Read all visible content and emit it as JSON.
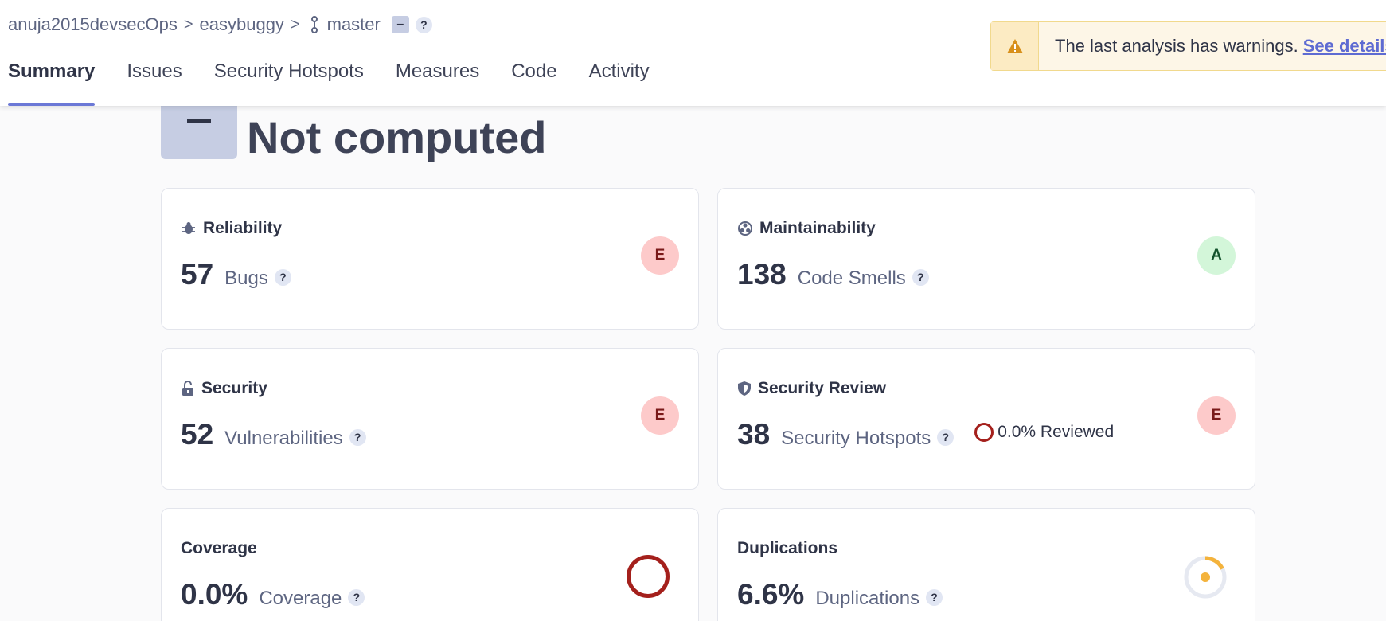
{
  "breadcrumb": {
    "organization": "anuja2015devsecOps",
    "project": "easybuggy",
    "branch": "master",
    "sep": ">",
    "badge": "–",
    "help": "?"
  },
  "tabs": [
    {
      "label": "Summary",
      "active": true
    },
    {
      "label": "Issues"
    },
    {
      "label": "Security Hotspots"
    },
    {
      "label": "Measures"
    },
    {
      "label": "Code"
    },
    {
      "label": "Activity"
    }
  ],
  "warning": {
    "text": "The last analysis has warnings.",
    "link": "See details"
  },
  "quality_gate": {
    "status": "Not computed"
  },
  "cards": {
    "reliability": {
      "title": "Reliability",
      "value": "57",
      "label": "Bugs",
      "rating": "E",
      "icon": "bug-icon"
    },
    "maintainability": {
      "title": "Maintainability",
      "value": "138",
      "label": "Code Smells",
      "rating": "A",
      "icon": "maintainability-icon"
    },
    "security": {
      "title": "Security",
      "value": "52",
      "label": "Vulnerabilities",
      "rating": "E",
      "icon": "lock-icon"
    },
    "security_review": {
      "title": "Security Review",
      "value": "38",
      "label": "Security Hotspots",
      "reviewed": "0.0% Reviewed",
      "rating": "E",
      "icon": "shield-icon"
    },
    "coverage": {
      "title": "Coverage",
      "value": "0.0%",
      "label": "Coverage",
      "percent": 0.0
    },
    "duplications": {
      "title": "Duplications",
      "value": "6.6%",
      "label": "Duplications",
      "percent": 6.6
    }
  },
  "colors": {
    "accent": "#6b78d6",
    "rating_e_bg": "#fdcaca",
    "rating_a_bg": "#d3f6d9",
    "warning_bg": "#fdf6e7",
    "coverage_ring": "#a4201c",
    "duplication_ring": "#f4b33c"
  }
}
